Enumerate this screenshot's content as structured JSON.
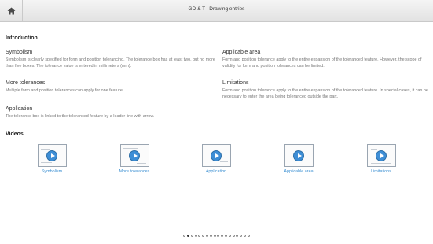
{
  "header": {
    "title": "GD & T | Drawing entries",
    "home_icon": "home-icon"
  },
  "introduction": {
    "heading": "Introduction",
    "blocks": [
      {
        "id": "symbolism",
        "title": "Symbolism",
        "text": "Symbolism is clearly specified for form and position tolerancing. The tolerance box has at least two, but no more than five boxes. The tolerance value is entered in millimeters (mm)."
      },
      {
        "id": "applicable-area",
        "title": "Applicable area",
        "text": "Form and position tolerance apply to the entire expansion of the toleranced feature. However, the scope of validity for form and position tolerances can be limited."
      },
      {
        "id": "more-tolerances",
        "title": "More tolerances",
        "text": "Multiple form and position tolerances can apply for one feature."
      },
      {
        "id": "limitations",
        "title": "Limitations",
        "text": "Form and position tolerance apply to the entire expansion of the toleranced feature. In special cases, it can be necessary to enter the area being toleranced outside the part."
      },
      {
        "id": "application",
        "title": "Application",
        "text": "The tolerance box is linked to the toleranced feature by a leader line with arrow."
      }
    ]
  },
  "videos": {
    "heading": "Videos",
    "items": [
      {
        "label": "Symbolism"
      },
      {
        "label": "More tolerances"
      },
      {
        "label": "Application"
      },
      {
        "label": "Applicable area"
      },
      {
        "label": "Limitations"
      }
    ]
  },
  "pager": {
    "count": 18,
    "active_index": 1
  }
}
